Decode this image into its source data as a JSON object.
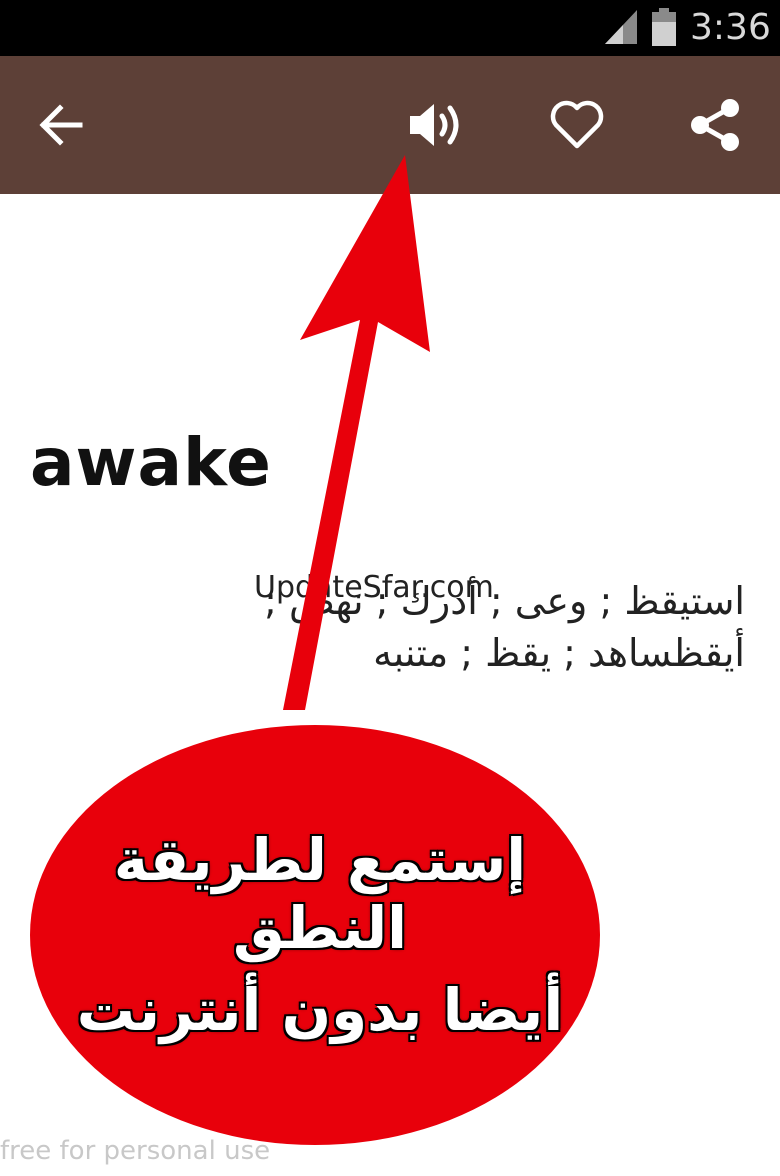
{
  "status_bar": {
    "time": "3:36",
    "icons": [
      "signal-icon",
      "battery-icon"
    ]
  },
  "toolbar": {
    "icons": [
      "back-arrow-icon",
      "speaker-icon",
      "heart-icon",
      "share-icon"
    ],
    "background_color": "#5d4037"
  },
  "entry": {
    "word": "awake",
    "translation": "استيقظ ; وعى ; أدرك ; نهض ; أيقظساهد ; يقظ ; متنبه"
  },
  "watermark": "UpdateSfar.com",
  "callout": {
    "line1": "إستمع لطريقة النطق",
    "line2": "أيضا بدون أنترنت",
    "fill_color": "#e8000b"
  },
  "footer_note": "free for personal use"
}
